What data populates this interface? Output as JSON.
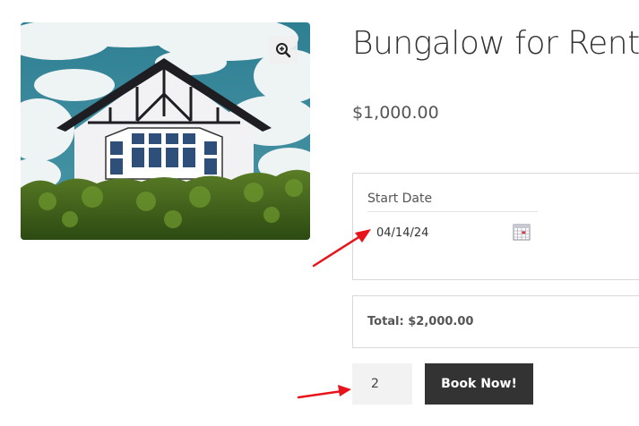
{
  "product": {
    "title": "Bungalow for Rent",
    "price": "$1,000.00",
    "image_alt": "bungalow-house-photo"
  },
  "booking": {
    "start_date_label": "Start Date",
    "start_date_value": "04/14/24",
    "total_text": "Total: $2,000.00",
    "quantity_value": "2",
    "book_button_label": "Book Now!"
  },
  "icons": {
    "zoom": "magnifier-plus-icon",
    "calendar": "calendar-icon"
  },
  "colors": {
    "button_bg": "#333333",
    "annotation_arrow": "#e8141b"
  }
}
